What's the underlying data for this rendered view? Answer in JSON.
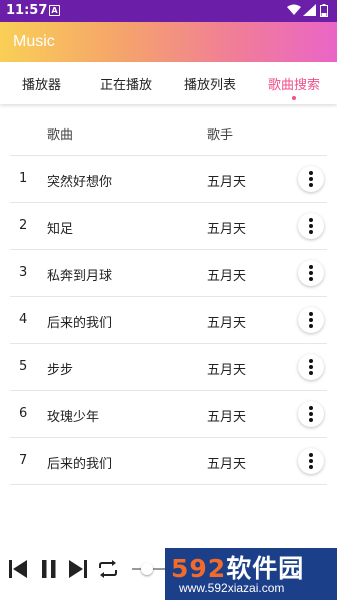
{
  "status_bar": {
    "time": "11:57",
    "notification_icon": "A"
  },
  "app_bar": {
    "title": "Music"
  },
  "tabs": [
    {
      "label": "播放器"
    },
    {
      "label": "正在播放"
    },
    {
      "label": "播放列表"
    },
    {
      "label": "歌曲搜索",
      "active": true
    }
  ],
  "song_list": {
    "headers": {
      "name": "歌曲",
      "artist": "歌手"
    },
    "rows": [
      {
        "num": "1",
        "name": "突然好想你",
        "artist": "五月天"
      },
      {
        "num": "2",
        "name": "知足",
        "artist": "五月天"
      },
      {
        "num": "3",
        "name": "私奔到月球",
        "artist": "五月天"
      },
      {
        "num": "4",
        "name": "后来的我们",
        "artist": "五月天"
      },
      {
        "num": "5",
        "name": "步步",
        "artist": "五月天"
      },
      {
        "num": "6",
        "name": "玫瑰少年",
        "artist": "五月天"
      },
      {
        "num": "7",
        "name": "后来的我们",
        "artist": "五月天"
      }
    ]
  },
  "player_controls": [
    "previous-icon",
    "pause-icon",
    "next-icon",
    "repeat-icon"
  ],
  "watermark": {
    "brand_digits": "592",
    "brand_text": "软件园",
    "url": "www.592xiazai.com"
  },
  "colors": {
    "accent": "#f0508a",
    "status_bar": "#6b1fa8",
    "watermark_bg": "#1c3f8a",
    "watermark_orange": "#f26b2a"
  }
}
